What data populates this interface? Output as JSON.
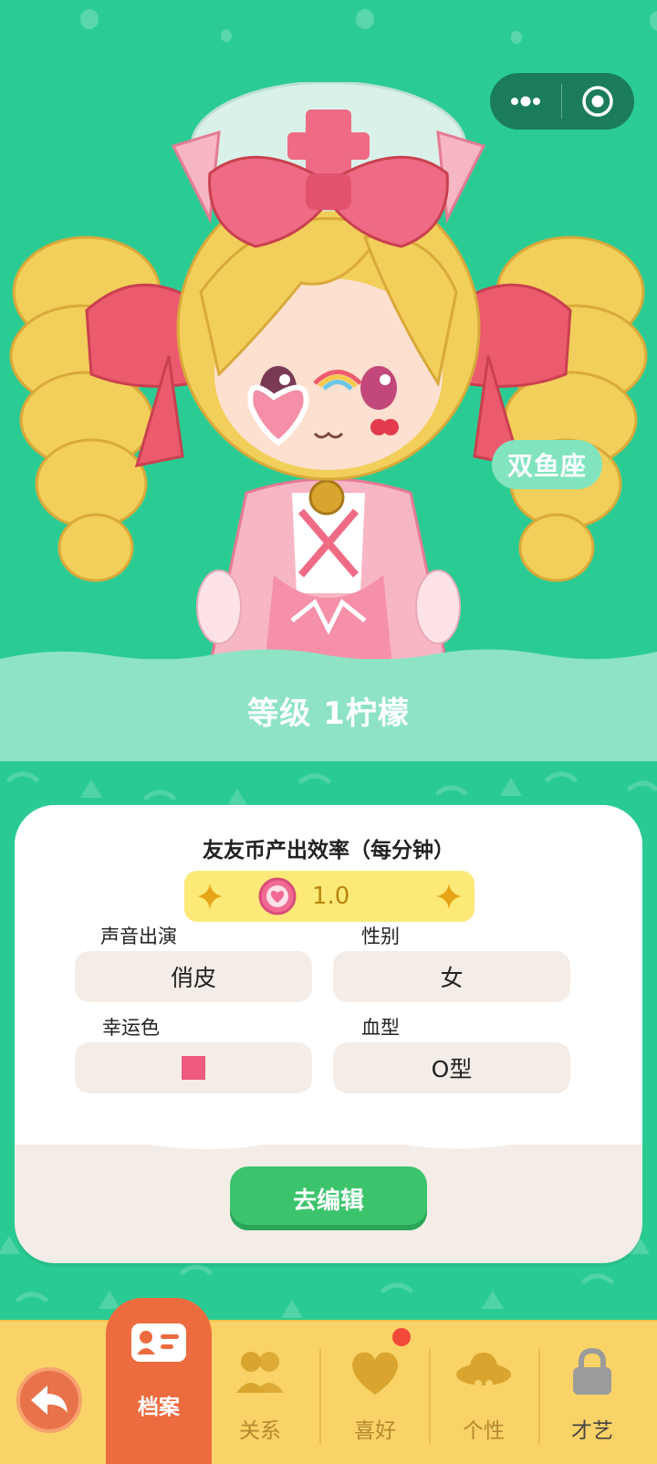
{
  "colors": {
    "background": "#2bcc94",
    "accent_orange": "#ec6b3f",
    "button_green": "#3cc46c",
    "tabbar_yellow": "#f9d367",
    "lucky_color": "#f05a7e"
  },
  "capsule": {
    "more_icon": "more-dots-icon",
    "close_icon": "target-circle-icon"
  },
  "profile": {
    "zodiac": "双鱼座",
    "level": "等级 1柠檬"
  },
  "card": {
    "title": "友友币产出效率（每分钟）",
    "rate": "1.0",
    "fields": {
      "voice_label": "声音出演",
      "voice_value": "俏皮",
      "gender_label": "性别",
      "gender_value": "女",
      "lucky_label": "幸运色",
      "blood_label": "血型",
      "blood_value": "O型"
    },
    "edit_button": "去编辑"
  },
  "tabbar": {
    "tabs": [
      {
        "label": "档案",
        "icon": "profile-card-icon",
        "active": true
      },
      {
        "label": "关系",
        "icon": "people-icon",
        "active": false
      },
      {
        "label": "喜好",
        "icon": "heart-icon",
        "active": false
      },
      {
        "label": "个性",
        "icon": "hat-icon",
        "active": false
      },
      {
        "label": "才艺",
        "icon": "lock-icon",
        "active": false
      }
    ]
  }
}
